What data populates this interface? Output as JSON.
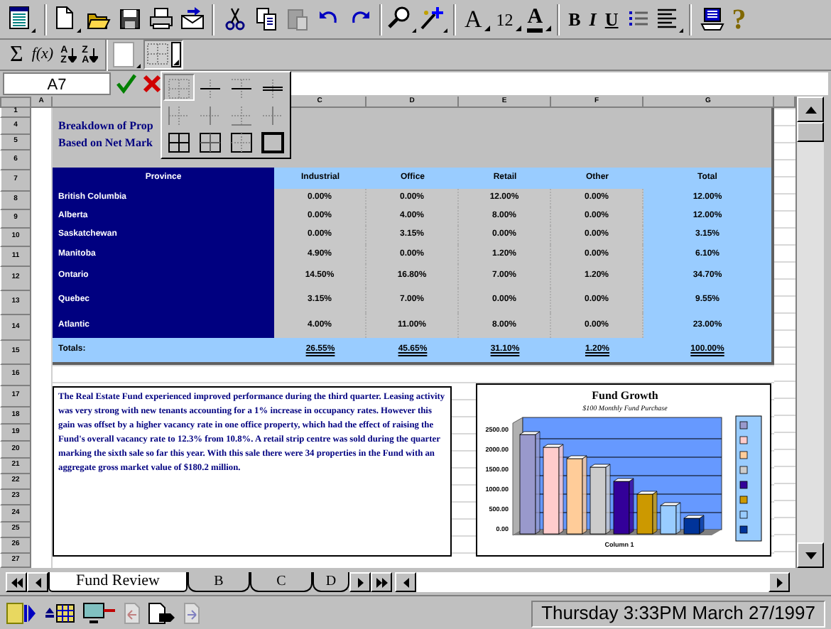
{
  "toolbar": {
    "font_button": "A",
    "font_size": "12",
    "font_color_button": "A",
    "bold": "B",
    "italic": "I",
    "underline": "U",
    "help": "?"
  },
  "toolbar_2": {
    "sum": "Σ",
    "function": "f(x)",
    "sort_ascending": [
      "A",
      "Z"
    ],
    "sort_descending": [
      "Z",
      "A"
    ]
  },
  "name_box": "A7",
  "column_headers": [
    "A",
    "C",
    "D",
    "E",
    "F",
    "G"
  ],
  "row_headers": [
    "1",
    "4",
    "5",
    "6",
    "7",
    "8",
    "9",
    "10",
    "11",
    "12",
    "13",
    "14",
    "15",
    "16",
    "17",
    "18",
    "19",
    "20",
    "21",
    "22",
    "23",
    "24",
    "25",
    "26",
    "27"
  ],
  "sheet": {
    "title_lines": [
      "Breakdown of Prop",
      "Based on Net Mark"
    ],
    "table": {
      "columns": [
        "Province",
        "Industrial",
        "Office",
        "Retail",
        "Other",
        "Total"
      ],
      "rows": [
        {
          "province": "British Columbia",
          "values": [
            "0.00%",
            "0.00%",
            "12.00%",
            "0.00%",
            "12.00%"
          ]
        },
        {
          "province": "Alberta",
          "values": [
            "0.00%",
            "4.00%",
            "8.00%",
            "0.00%",
            "12.00%"
          ]
        },
        {
          "province": "Saskatchewan",
          "values": [
            "0.00%",
            "3.15%",
            "0.00%",
            "0.00%",
            "3.15%"
          ]
        },
        {
          "province": "Manitoba",
          "values": [
            "4.90%",
            "0.00%",
            "1.20%",
            "0.00%",
            "6.10%"
          ]
        },
        {
          "province": "Ontario",
          "values": [
            "14.50%",
            "16.80%",
            "7.00%",
            "1.20%",
            "34.70%"
          ]
        },
        {
          "province": "Quebec",
          "values": [
            "3.15%",
            "7.00%",
            "0.00%",
            "0.00%",
            "9.55%"
          ]
        },
        {
          "province": "Atlantic",
          "values": [
            "4.00%",
            "11.00%",
            "8.00%",
            "0.00%",
            "23.00%"
          ]
        }
      ],
      "totals": {
        "label": "Totals:",
        "values": [
          "26.55%",
          "45.65%",
          "31.10%",
          "1.20%",
          "100.00%"
        ]
      }
    },
    "note": "The Real Estate Fund experienced improved performance during the third quarter. Leasing activity was very strong with new tenants accounting for a 1% increase in occupancy rates. However this gain was offset by a higher vacancy rate in one office property, which had the effect of raising the Fund's overall vacancy rate to 12.3% from 10.8%. A retail strip centre was sold during the quarter marking the sixth sale so far this year. With this sale there were 34 properties in the Fund with an aggregate gross market value of $180.2 million.",
    "chart": {
      "title": "Fund Growth",
      "subtitle": "$100 Monthly Fund Purchase",
      "axis_labels": [
        "2500.00",
        "2000.00",
        "1500.00",
        "1000.00",
        "500.00",
        "0.00"
      ],
      "xlabel": "Column 1"
    }
  },
  "sheet_tabs": [
    {
      "label": "Fund Review",
      "selected": true
    },
    {
      "label": "B",
      "selected": false
    },
    {
      "label": "C",
      "selected": false
    },
    {
      "label": "D",
      "selected": false
    }
  ],
  "status_bar": {
    "datetime": "Thursday 3:33PM March 27/1997"
  }
}
